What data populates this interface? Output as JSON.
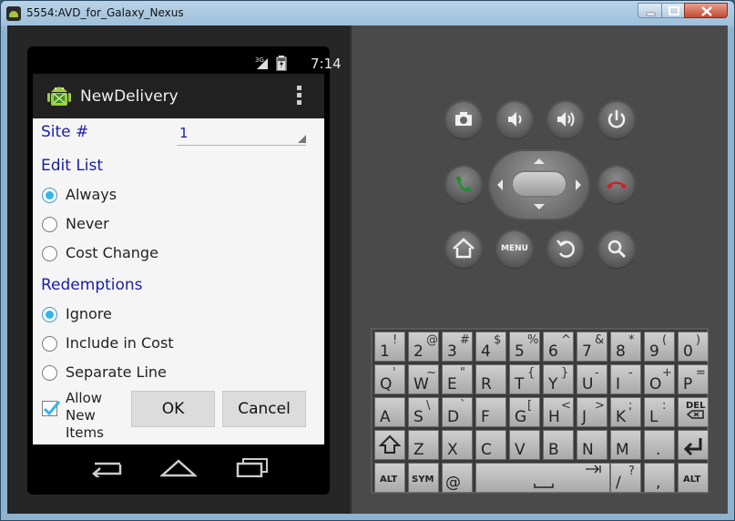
{
  "window": {
    "title": "5554:AVD_for_Galaxy_Nexus"
  },
  "status_bar": {
    "network": "3G",
    "time": "7:14"
  },
  "app": {
    "title": "NewDelivery"
  },
  "form": {
    "site_label": "Site #",
    "site_value": "1",
    "edit_list_label": "Edit List",
    "edit_list_options": [
      {
        "label": "Always",
        "selected": true
      },
      {
        "label": "Never",
        "selected": false
      },
      {
        "label": "Cost Change",
        "selected": false
      }
    ],
    "redemptions_label": "Redemptions",
    "redemptions_options": [
      {
        "label": "Ignore",
        "selected": true
      },
      {
        "label": "Include in Cost",
        "selected": false
      },
      {
        "label": "Separate Line",
        "selected": false
      }
    ],
    "allow_new_items": {
      "label": "Allow New Items",
      "checked": true
    },
    "ok_label": "OK",
    "cancel_label": "Cancel"
  },
  "hardware": {
    "menu_label": "MENU"
  },
  "keyboard": {
    "rows": [
      [
        {
          "p": "1",
          "s": "!"
        },
        {
          "p": "2",
          "s": "@"
        },
        {
          "p": "3",
          "s": "#"
        },
        {
          "p": "4",
          "s": "$"
        },
        {
          "p": "5",
          "s": "%"
        },
        {
          "p": "6",
          "s": "^"
        },
        {
          "p": "7",
          "s": "&"
        },
        {
          "p": "8",
          "s": "*"
        },
        {
          "p": "9",
          "s": "("
        },
        {
          "p": "0",
          "s": ")"
        }
      ],
      [
        {
          "p": "Q",
          "s": "'"
        },
        {
          "p": "W",
          "s": "~"
        },
        {
          "p": "E",
          "s": "\""
        },
        {
          "p": "R",
          "s": ""
        },
        {
          "p": "T",
          "s": "{"
        },
        {
          "p": "Y",
          "s": "}"
        },
        {
          "p": "U",
          "s": "-"
        },
        {
          "p": "I",
          "s": "-"
        },
        {
          "p": "O",
          "s": "+"
        },
        {
          "p": "P",
          "s": "="
        }
      ],
      [
        {
          "p": "A",
          "s": ""
        },
        {
          "p": "S",
          "s": "\\"
        },
        {
          "p": "D",
          "s": "`"
        },
        {
          "p": "F",
          "s": ""
        },
        {
          "p": "G",
          "s": "["
        },
        {
          "p": "H",
          "s": "<"
        },
        {
          "p": "J",
          "s": ">"
        },
        {
          "p": "K",
          "s": ";"
        },
        {
          "p": "L",
          "s": ":"
        }
      ],
      [
        {
          "p": "Z",
          "s": ""
        },
        {
          "p": "X",
          "s": ""
        },
        {
          "p": "C",
          "s": ""
        },
        {
          "p": "V",
          "s": ""
        },
        {
          "p": "B",
          "s": ""
        },
        {
          "p": "N",
          "s": ""
        },
        {
          "p": "M",
          "s": ""
        },
        {
          "p": ".",
          "s": ""
        }
      ],
      [
        {
          "p": "@",
          "s": ""
        },
        {
          "p": "/",
          "s": "?"
        },
        {
          "p": ",",
          "s": ""
        }
      ]
    ],
    "del_label": "DEL",
    "alt_label": "ALT",
    "sym_label": "SYM"
  }
}
